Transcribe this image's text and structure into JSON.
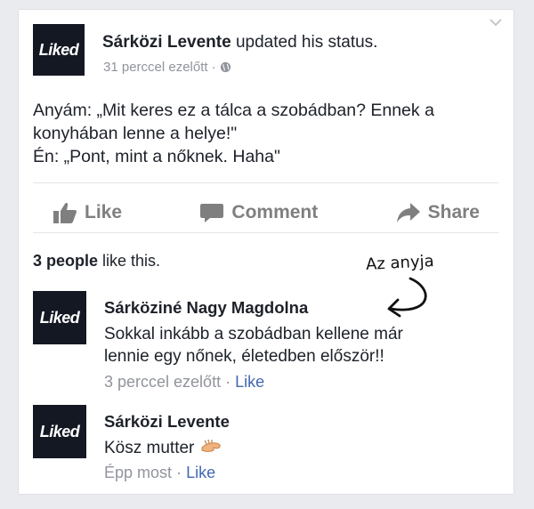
{
  "post": {
    "avatar_text": "Liked",
    "author": "Sárközi Levente",
    "action_text": "updated his status.",
    "time": "31 perccel ezelőtt",
    "separator": "·",
    "lines": [
      "Anyám: „Mit keres ez a tálca a szobádban? Ennek a",
      "konyhában lenne a helye!\"",
      "Én: „Pont, mint a nőknek. Haha\""
    ]
  },
  "actions": {
    "like": "Like",
    "comment": "Comment",
    "share": "Share"
  },
  "likes": {
    "bold": "3 people",
    "rest": " like this."
  },
  "annotation": "Az anyja",
  "comments": [
    {
      "avatar_text": "Liked",
      "name": "Sárköziné Nagy Magdolna",
      "lines": [
        "Sokkal inkább a szobádban kellene már",
        "lennie egy nőnek, életedben először!!"
      ],
      "time": "3 perccel ezelőtt",
      "separator": "·",
      "like": "Like"
    },
    {
      "avatar_text": "Liked",
      "name": "Sárközi Levente",
      "lines": [
        "Kösz mutter"
      ],
      "time": "Épp most",
      "separator": "·",
      "like": "Like"
    }
  ],
  "colors": {
    "link": "#4267b2",
    "meta": "#90949c",
    "action": "#7f7f7f",
    "avatar_bg": "#141823"
  }
}
